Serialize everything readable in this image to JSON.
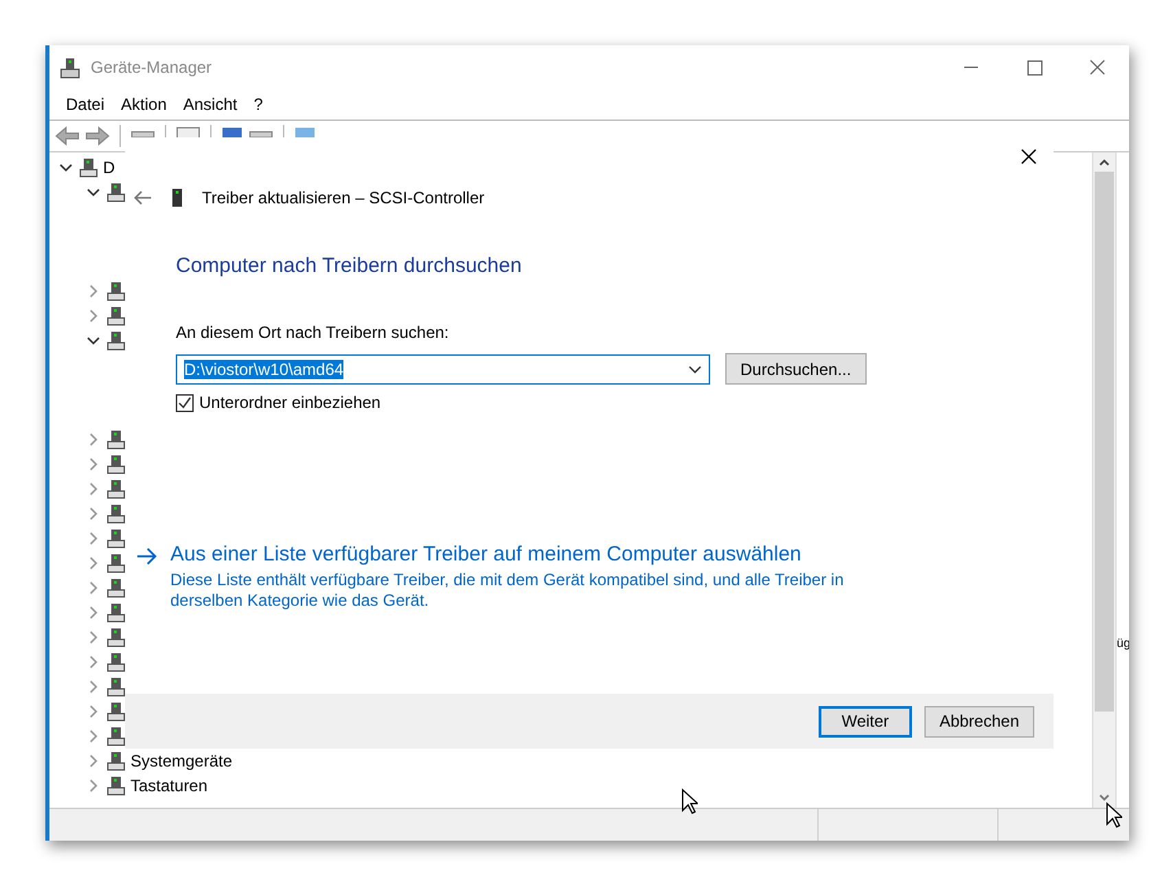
{
  "window": {
    "title": "Geräte-Manager"
  },
  "menu": [
    "Datei",
    "Aktion",
    "Ansicht",
    "?"
  ],
  "tree": [
    {
      "label": "D",
      "expanded": true,
      "children": [
        {
          "expanded": true
        },
        {
          "expanded": false
        },
        {
          "expanded": false
        },
        {
          "expanded": true
        },
        {
          "expanded": false
        },
        {
          "expanded": false
        },
        {
          "expanded": false
        },
        {
          "expanded": false
        },
        {
          "expanded": false
        },
        {
          "expanded": false
        },
        {
          "expanded": false
        },
        {
          "expanded": false
        },
        {
          "expanded": false
        },
        {
          "expanded": false
        },
        {
          "expanded": false
        },
        {
          "expanded": false
        },
        {
          "expanded": false
        },
        {
          "label": "Systemgeräte",
          "expanded": false
        },
        {
          "label": "Tastaturen",
          "expanded": false
        }
      ]
    }
  ],
  "side_pane": {
    "partial_text": "üg"
  },
  "dialog": {
    "title": "Treiber aktualisieren – SCSI-Controller",
    "heading": "Computer nach Treibern durchsuchen",
    "location_label": "An diesem Ort nach Treibern suchen:",
    "path": {
      "value": "D:\\viostor\\w10\\amd64",
      "text_selected": true
    },
    "browse_button": "Durchsuchen...",
    "include_subfolders": {
      "label": "Unterordner einbeziehen",
      "checked": true
    },
    "pick_link": {
      "label": "Aus einer Liste verfügbarer Treiber auf meinem Computer auswählen",
      "description": "Diese Liste enthält verfügbare Treiber, die mit dem Gerät kompatibel sind, und alle Treiber in derselben Kategorie wie das Gerät."
    },
    "buttons": [
      {
        "label": "Weiter",
        "default": true
      },
      {
        "label": "Abbrechen",
        "default": false
      }
    ]
  }
}
